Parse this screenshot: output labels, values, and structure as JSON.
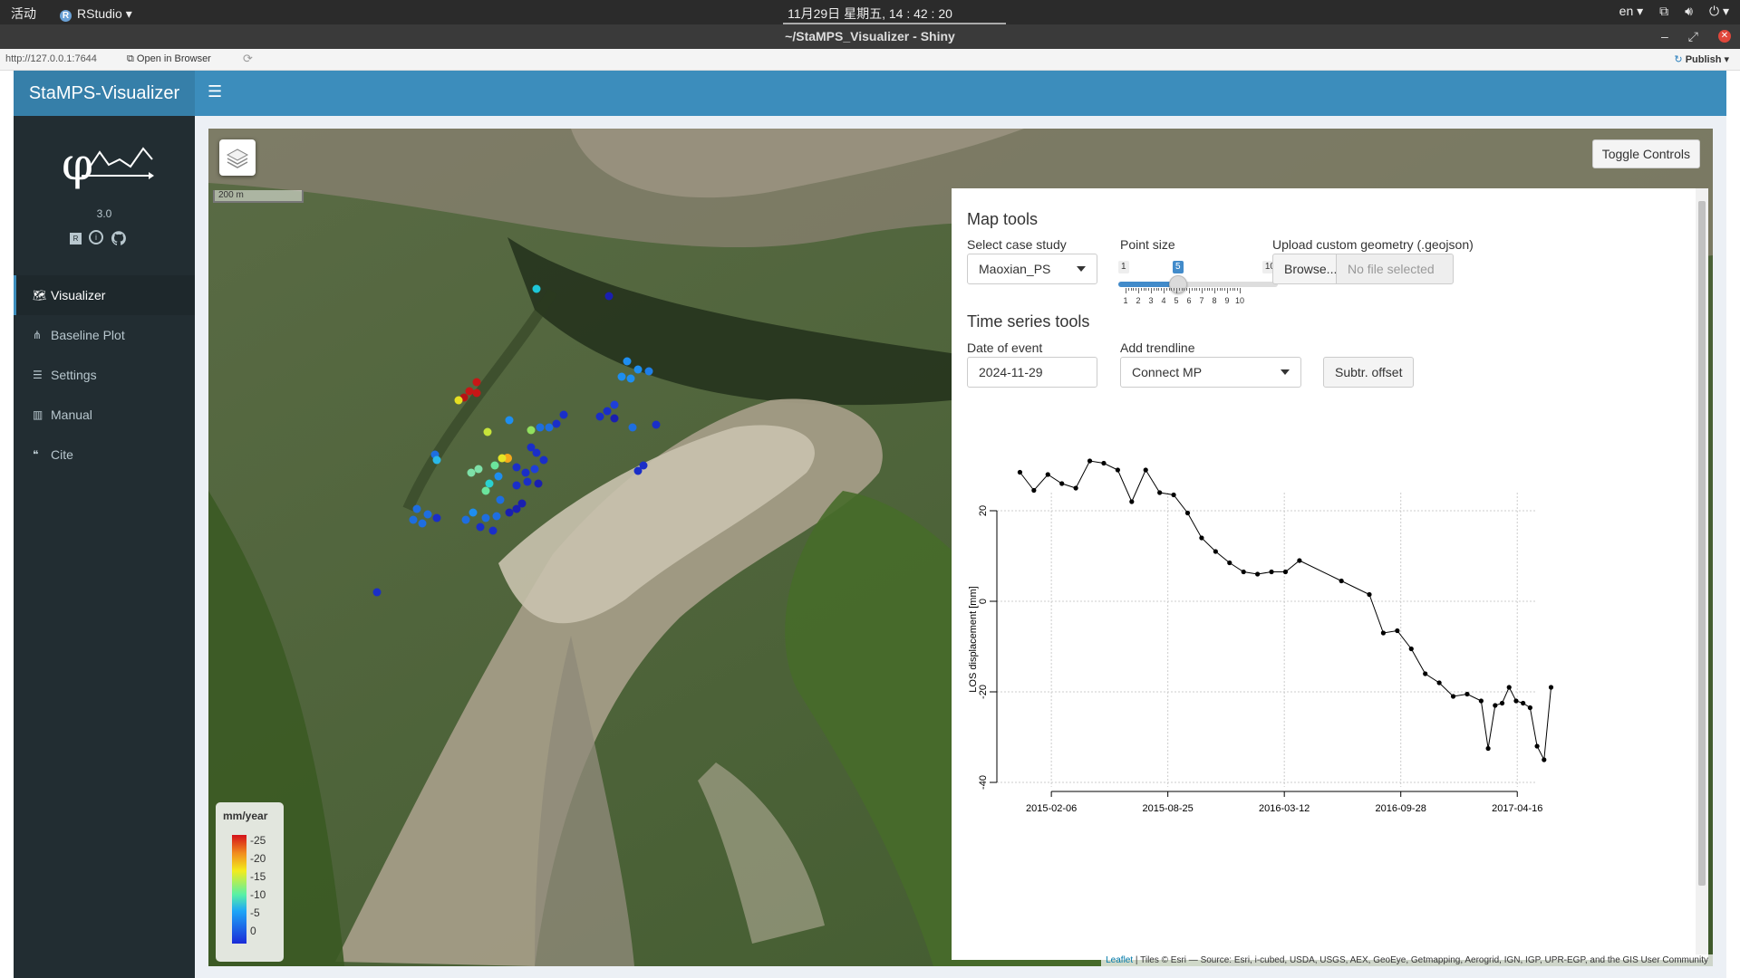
{
  "topbar": {
    "activities": "活动",
    "app_name": "RStudio",
    "clock": "11月29日 星期五, 14 : 42 : 20",
    "lang": "en"
  },
  "window": {
    "title": "~/StaMPS_Visualizer - Shiny"
  },
  "viewer": {
    "url": "http://127.0.0.1:7644",
    "open_browser": "Open in Browser",
    "publish": "Publish"
  },
  "app": {
    "brand": "StaMPS-Visualizer",
    "version": "3.0",
    "menu": [
      {
        "label": "Visualizer",
        "icon": "map-icon",
        "active": true
      },
      {
        "label": "Baseline Plot",
        "icon": "network-icon",
        "active": false
      },
      {
        "label": "Settings",
        "icon": "sliders-icon",
        "active": false
      },
      {
        "label": "Manual",
        "icon": "book-icon",
        "active": false
      },
      {
        "label": "Cite",
        "icon": "quote-icon",
        "active": false
      }
    ]
  },
  "map": {
    "scale": "200 m",
    "toggle": "Toggle Controls",
    "legend": {
      "title": "mm/year",
      "labels": [
        "-25",
        "-20",
        "-15",
        "-10",
        "-5",
        "0"
      ]
    },
    "attribution_link": "Leaflet",
    "attribution_text": " | Tiles © Esri — Source: Esri, i-cubed, USDA, USGS, AEX, GeoEye, Getmapping, Aerogrid, IGN, IGP, UPR-EGP, and the GIS User Community"
  },
  "controls": {
    "map_tools_title": "Map tools",
    "case_label": "Select case study",
    "case_value": "Maoxian_PS",
    "point_label": "Point size",
    "point": {
      "min": 1,
      "max": 10,
      "value": 5
    },
    "point_min_label": "1",
    "point_max_label": "10",
    "point_value_label": "5",
    "upload_label": "Upload custom geometry (.geojson)",
    "browse": "Browse...",
    "no_file": "No file selected",
    "ts_title": "Time series tools",
    "date_label": "Date of event",
    "date_value": "2024-11-29",
    "trend_label": "Add trendline",
    "trend_value": "Connect MP",
    "offset_btn": "Subtr. offset"
  },
  "chart_data": {
    "type": "line",
    "ylabel": "LOS displacement [mm]",
    "ylim": [
      -40,
      30
    ],
    "yticks": [
      "20",
      "0",
      "-20",
      "-40"
    ],
    "xticks": [
      "2015-02-06",
      "2015-08-25",
      "2016-03-12",
      "2016-09-28",
      "2017-04-16"
    ],
    "grid": true,
    "x": [
      "2014-12-14",
      "2015-01-07",
      "2015-01-31",
      "2015-02-24",
      "2015-03-20",
      "2015-04-13",
      "2015-05-07",
      "2015-05-31",
      "2015-06-24",
      "2015-07-18",
      "2015-08-11",
      "2015-09-04",
      "2015-09-28",
      "2015-10-22",
      "2015-11-15",
      "2015-12-09",
      "2016-01-02",
      "2016-01-26",
      "2016-02-19",
      "2016-03-14",
      "2016-04-07",
      "2016-06-18",
      "2016-08-05",
      "2016-08-29",
      "2016-09-22",
      "2016-10-16",
      "2016-11-09",
      "2016-12-03",
      "2016-12-27",
      "2017-01-20",
      "2017-02-13",
      "2017-02-25",
      "2017-03-09",
      "2017-03-21",
      "2017-04-02",
      "2017-04-14",
      "2017-04-26",
      "2017-05-08",
      "2017-05-20",
      "2017-06-01",
      "2017-06-13"
    ],
    "values": [
      28.5,
      24.5,
      28,
      26,
      25,
      31,
      30.5,
      29,
      22,
      29,
      24,
      23.5,
      19.5,
      14,
      11,
      8.5,
      6.5,
      6,
      6.5,
      6.5,
      9,
      4.5,
      1.5,
      -7,
      -6.5,
      -10.5,
      -16,
      -18,
      -21,
      -20.5,
      -22,
      -32.5,
      -23,
      -22.5,
      -19,
      -22,
      -22.5,
      -23.5,
      -32,
      -35,
      -19
    ]
  }
}
